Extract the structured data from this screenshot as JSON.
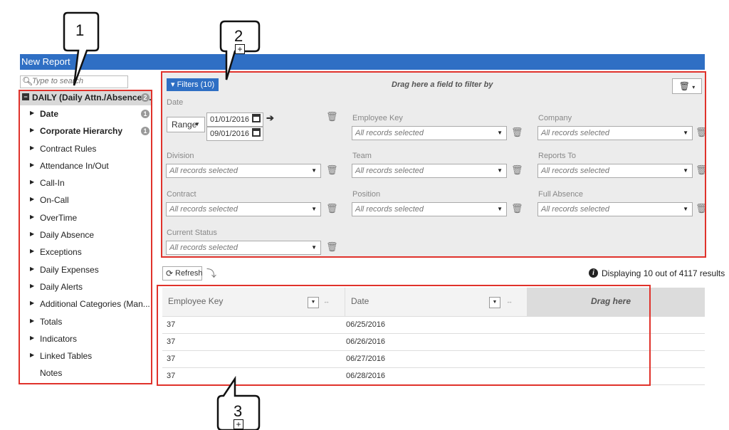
{
  "window": {
    "title": "New Report"
  },
  "sidebar": {
    "search_placeholder": "Type to search",
    "root": {
      "label": "DAILY (Daily Attn./Absence ...",
      "badge": "2"
    },
    "items": [
      {
        "label": "Date",
        "bold": true,
        "badge": "1"
      },
      {
        "label": "Corporate Hierarchy",
        "bold": true,
        "badge": "1"
      },
      {
        "label": "Contract Rules"
      },
      {
        "label": "Attendance In/Out"
      },
      {
        "label": "Call-In"
      },
      {
        "label": "On-Call"
      },
      {
        "label": "OverTime"
      },
      {
        "label": "Daily Absence"
      },
      {
        "label": "Exceptions"
      },
      {
        "label": "Daily Expenses"
      },
      {
        "label": "Daily Alerts"
      },
      {
        "label": "Additional Categories (Man..."
      },
      {
        "label": "Totals"
      },
      {
        "label": "Indicators"
      },
      {
        "label": "Linked Tables"
      },
      {
        "label": "Notes"
      }
    ]
  },
  "filters": {
    "button_label": "Filters (10)",
    "drag_hint": "Drag here a field to filter by",
    "date": {
      "label": "Date",
      "mode": "Range",
      "from": "01/01/2016",
      "to": "09/01/2016"
    },
    "placeholder": "All records selected",
    "fields": {
      "employee_key": "Employee Key",
      "company": "Company",
      "division": "Division",
      "team": "Team",
      "reports_to": "Reports To",
      "contract": "Contract",
      "position": "Position",
      "full_absence": "Full Absence",
      "current_status": "Current Status"
    }
  },
  "toolbar": {
    "refresh_label": "Refresh",
    "display_text": "Displaying 10 out of 4117 results"
  },
  "table": {
    "columns": [
      "Employee Key",
      "Date"
    ],
    "drag_here": "Drag here",
    "rows": [
      {
        "employee_key": "37",
        "date": "06/25/2016"
      },
      {
        "employee_key": "37",
        "date": "06/26/2016"
      },
      {
        "employee_key": "37",
        "date": "06/27/2016"
      },
      {
        "employee_key": "37",
        "date": "06/28/2016"
      }
    ]
  },
  "annotations": {
    "callout_1": "1",
    "callout_2": "2",
    "callout_3": "3",
    "color": "#e0322b"
  },
  "colors": {
    "accent": "#2f6fc4",
    "panel": "#ececec"
  }
}
